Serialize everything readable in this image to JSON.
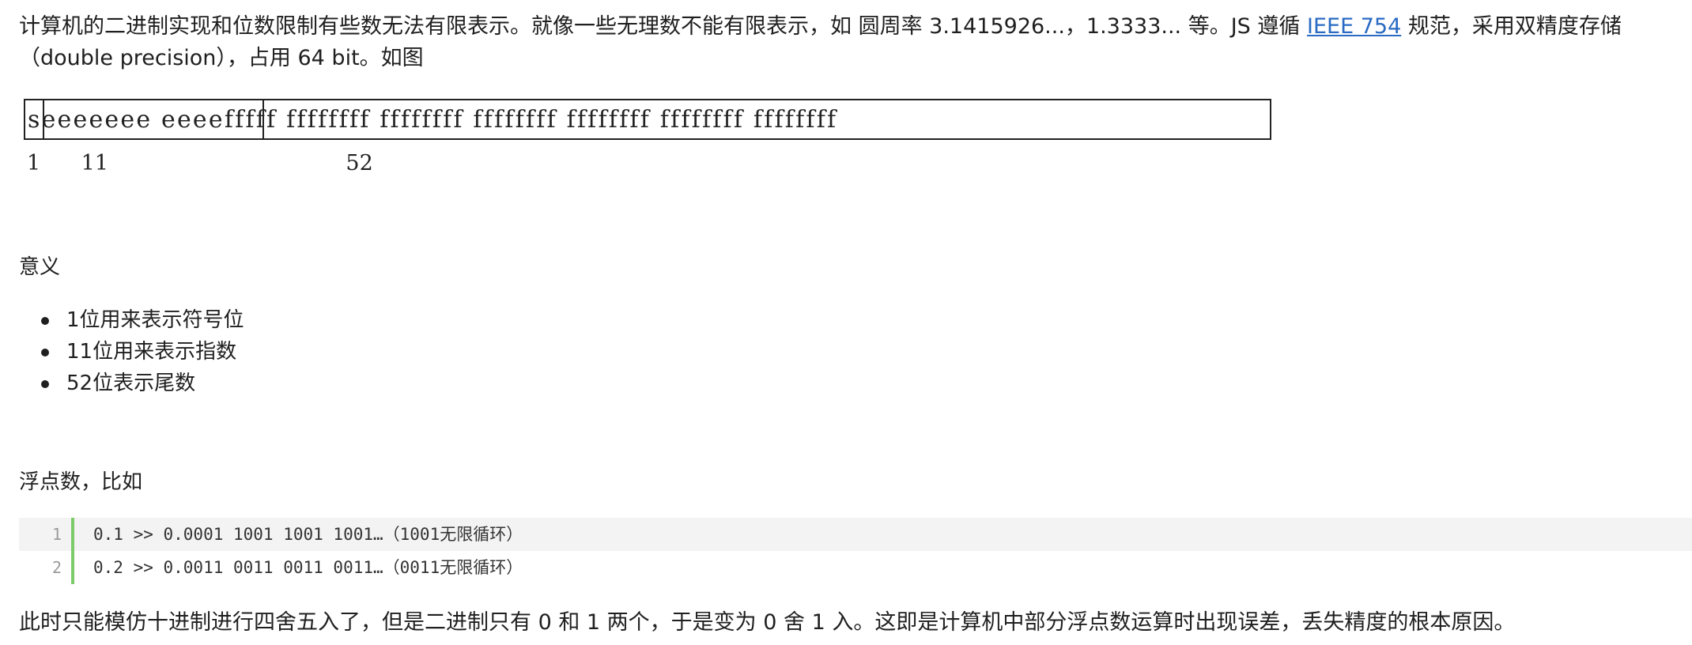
{
  "intro": {
    "text_before_link": "计算机的二进制实现和位数限制有些数无法有限表示。就像一些无理数不能有限表示，如 圆周率 3.1415926...，1.3333... 等。JS 遵循 ",
    "link_text": "IEEE 754",
    "text_after_link": " 规范，采用双精度存储（double precision），占用 64 bit。如图"
  },
  "bit_layout": {
    "bits_line": "seeeeeee eeeefffff ffffffff ffffffff ffffffff ffffffff ffffffff ffffffff",
    "counts_line": "1      11                                   52"
  },
  "meaning": {
    "heading": "意义",
    "items": [
      "1位用来表示符号位",
      "11位用来表示指数",
      "52位表示尾数"
    ]
  },
  "float_example": {
    "heading": "浮点数，比如",
    "lines": [
      {
        "number": "1",
        "code": "0.1 >> 0.0001 1001 1001 1001…（1001无限循环）"
      },
      {
        "number": "2",
        "code": "0.2 >> 0.0011 0011 0011 0011…（0011无限循环）"
      }
    ]
  },
  "conclusion": "此时只能模仿十进制进行四舍五入了，但是二进制只有 0 和 1 两个，于是变为 0 舍 1 入。这即是计算机中部分浮点数运算时出现误差，丢失精度的根本原因。",
  "colors": {
    "link": "#2a6bc4",
    "code_gutter": "#7ccb6b",
    "code_highlight": "#f3f3f3"
  }
}
